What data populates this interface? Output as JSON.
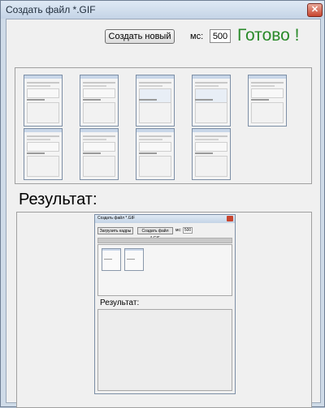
{
  "window": {
    "title": "Создать файл *.GIF",
    "close_glyph": "✕"
  },
  "toolbar": {
    "create_label": "Создать новый",
    "ms_label": "мс:",
    "ms_value": "500"
  },
  "status": {
    "text": "Готово !",
    "color": "#2a8a2a"
  },
  "frames": {
    "count": 9
  },
  "result": {
    "label": "Результат:"
  },
  "preview": {
    "title": "Создать файл *.GIF",
    "load_label": "Загрузить кадры",
    "create_label": "Создать файл *.GIF",
    "ms_label": "мс:",
    "ms_value": "500",
    "result_label": "Результат:"
  }
}
